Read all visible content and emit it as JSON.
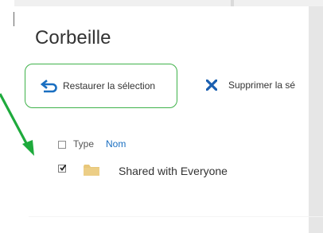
{
  "panel": {
    "title": "Corbeille"
  },
  "toolbar": {
    "restore_label": "Restaurer la sélection",
    "delete_label": "Supprimer la sé"
  },
  "list": {
    "columns": {
      "type": "Type",
      "name": "Nom"
    },
    "rows": [
      {
        "name": "Shared with Everyone",
        "type": "folder",
        "checked": true
      }
    ]
  },
  "icons": {
    "restore": "undo-arrow-icon",
    "delete": "close-x-icon",
    "folder": "folder-icon",
    "annotation": "green-arrow-icon"
  },
  "colors": {
    "highlight_border": "#3fb24a",
    "accent_blue": "#1a6fc1",
    "annotation_arrow": "#1eaa3c",
    "folder": "#e8c77a"
  }
}
